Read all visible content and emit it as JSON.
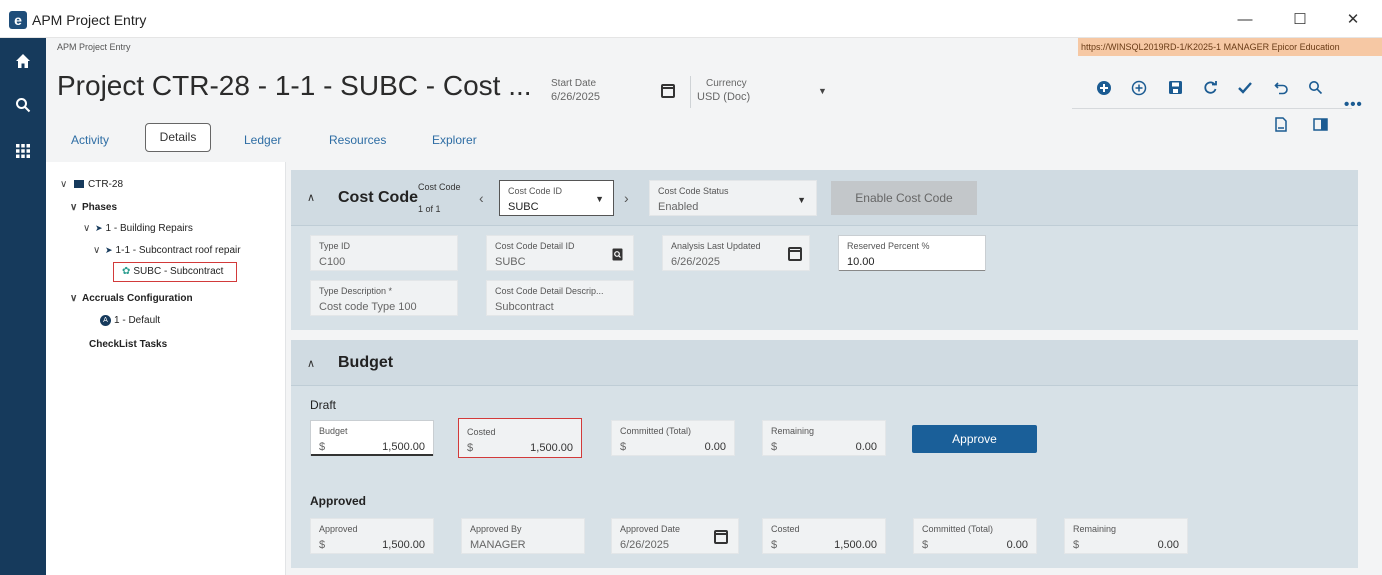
{
  "window": {
    "title": "APM Project Entry",
    "minimize": "—",
    "maximize": "☐",
    "close": "✕",
    "logo": "e"
  },
  "rail": {
    "icons": [
      "home-icon",
      "search-icon",
      "grid-icon"
    ]
  },
  "header": {
    "breadcrumb": "APM Project Entry",
    "env": "https://WINSQL2019RD-1/K2025-1   MANAGER   Epicor Education",
    "title": "Project CTR-28 - 1-1 - SUBC - Cost ...",
    "start_date_label": "Start Date",
    "start_date": "6/26/2025",
    "currency_label": "Currency",
    "currency": "USD (Doc)"
  },
  "toolbar": {
    "icons": [
      "add-circle-icon",
      "add-outline-icon",
      "save-icon",
      "refresh-icon",
      "check-icon",
      "undo-icon",
      "search-icon",
      "more-icon",
      "document-icon",
      "panel-icon"
    ]
  },
  "tabs": {
    "activity": "Activity",
    "details": "Details",
    "ledger": "Ledger",
    "resources": "Resources",
    "explorer": "Explorer"
  },
  "tree": {
    "root": "CTR-28",
    "phases": "Phases",
    "phase1": "1 - Building Repairs",
    "phase11": "1-1 - Subcontract roof repair",
    "subc": "SUBC - Subcontract",
    "accruals": "Accruals Configuration",
    "default": "1 - Default",
    "checklist": "CheckList Tasks"
  },
  "costcode": {
    "title": "Cost Code",
    "counter_label": "Cost Code",
    "counter": "1 of 1",
    "id_label": "Cost Code ID",
    "id": "SUBC",
    "status_label": "Cost Code Status",
    "status": "Enabled",
    "enable_button": "Enable Cost Code",
    "type_id_label": "Type ID",
    "type_id": "C100",
    "detail_id_label": "Cost Code Detail ID",
    "detail_id": "SUBC",
    "analysis_label": "Analysis Last Updated",
    "analysis": "6/26/2025",
    "reserved_label": "Reserved Percent %",
    "reserved": "10.00",
    "type_desc_label": "Type Description *",
    "type_desc": "Cost code Type 100",
    "detail_desc_label": "Cost Code Detail Descrip...",
    "detail_desc": "Subcontract"
  },
  "budget": {
    "title": "Budget",
    "draft_label": "Draft",
    "budget_label": "Budget",
    "budget": "1,500.00",
    "costed_label": "Costed",
    "costed": "1,500.00",
    "committed_label": "Committed (Total)",
    "committed": "0.00",
    "remaining_label": "Remaining",
    "remaining": "0.00",
    "currency": "$",
    "approve_button": "Approve",
    "approved_section": "Approved",
    "approved_label": "Approved",
    "approved": "1,500.00",
    "approved_by_label": "Approved By",
    "approved_by": "MANAGER",
    "approved_date_label": "Approved Date",
    "approved_date": "6/26/2025",
    "a_costed_label": "Costed",
    "a_costed": "1,500.00",
    "a_committed_label": "Committed (Total)",
    "a_committed": "0.00",
    "a_remaining_label": "Remaining",
    "a_remaining": "0.00"
  }
}
